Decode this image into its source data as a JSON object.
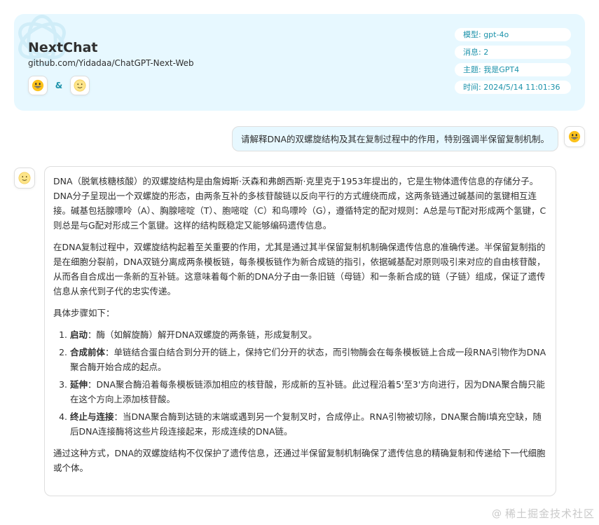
{
  "header": {
    "title": "NextChat",
    "subtitle": "github.com/Yidadaa/ChatGPT-Next-Web",
    "amp": "&",
    "meta": [
      "模型: gpt-4o",
      "消息: 2",
      "主题: 我是GPT4",
      "时间: 2024/5/14 11:01:36"
    ],
    "accent_color": "#1d93ab",
    "card_color": "#e7f8ff"
  },
  "chat": {
    "user_message": "请解释DNA的双螺旋结构及其在复制过程中的作用，特别强调半保留复制机制。",
    "bot": {
      "para1": "DNA（脱氧核糖核酸）的双螺旋结构是由詹姆斯·沃森和弗朗西斯·克里克于1953年提出的，它是生物体遗传信息的存储分子。DNA分子呈现出一个双螺旋的形态，由两条互补的多核苷酸链以反向平行的方式缠绕而成，这两条链通过碱基间的氢键相互连接。碱基包括腺嘌呤（A）、胸腺嘧啶（T）、胞嘧啶（C）和鸟嘌呤（G），遵循特定的配对规则：A总是与T配对形成两个氢键，C则总是与G配对形成三个氢键。这样的结构既稳定又能够编码遗传信息。",
      "para2": "在DNA复制过程中，双螺旋结构起着至关重要的作用，尤其是通过其半保留复制机制确保遗传信息的准确传递。半保留复制指的是在细胞分裂前，DNA双链分离成两条模板链，每条模板链作为新合成链的指引，依据碱基配对原则吸引来对应的自由核苷酸，从而各自合成出一条新的互补链。这意味着每个新的DNA分子由一条旧链（母链）和一条新合成的链（子链）组成，保证了遗传信息从亲代到子代的忠实传递。",
      "steps_intro": "具体步骤如下：",
      "steps": [
        {
          "title": "启动",
          "text": "：酶（如解旋酶）解开DNA双螺旋的两条链，形成复制叉。"
        },
        {
          "title": "合成前体",
          "text": "：单链结合蛋白结合到分开的链上，保持它们分开的状态，而引物酶会在每条模板链上合成一段RNA引物作为DNA聚合酶开始合成的起点。"
        },
        {
          "title": "延伸",
          "text": "：DNA聚合酶沿着每条模板链添加相应的核苷酸，形成新的互补链。此过程沿着5'至3'方向进行，因为DNA聚合酶只能在这个方向上添加核苷酸。"
        },
        {
          "title": "终止与连接",
          "text": "：当DNA聚合酶到达链的末端或遇到另一个复制叉时，合成停止。RNA引物被切除，DNA聚合酶I填充空缺，随后DNA连接酶将这些片段连接起来，形成连续的DNA链。"
        }
      ],
      "conclusion": "通过这种方式，DNA的双螺旋结构不仅保护了遗传信息，还通过半保留复制机制确保了遗传信息的精确复制和传递给下一代细胞或个体。"
    }
  },
  "watermark": {
    "at": "@",
    "text": "稀土掘金技术社区"
  },
  "icons": {
    "user_avatar": "grinning-face-icon",
    "bot_avatar": "slight-smile-face-icon",
    "logo": "openai-logo-icon"
  }
}
